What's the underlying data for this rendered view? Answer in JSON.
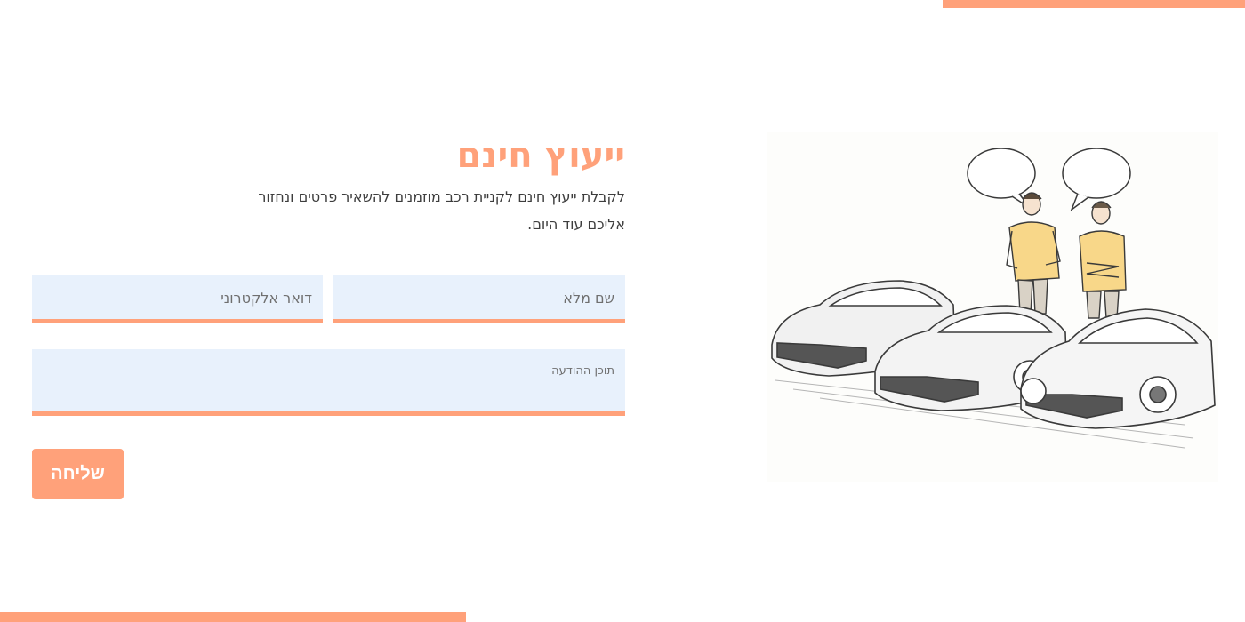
{
  "heading": {
    "title": "ייעוץ חינם",
    "subtitle": "לקבלת ייעוץ חינם לקניית רכב מוזמנים להשאיר פרטים ונחזור אליכם עוד היום."
  },
  "form": {
    "full_name_placeholder": "שם מלא",
    "email_placeholder": "דואר אלקטרוני",
    "message_placeholder": "תוכן  ההודעה",
    "submit_label": "שליחה"
  },
  "colors": {
    "accent": "#ffa17a",
    "field_background": "#e8f1fc",
    "text": "#3d3d3d"
  },
  "illustration": {
    "subject": "sports-cars-consultation-sketch"
  }
}
